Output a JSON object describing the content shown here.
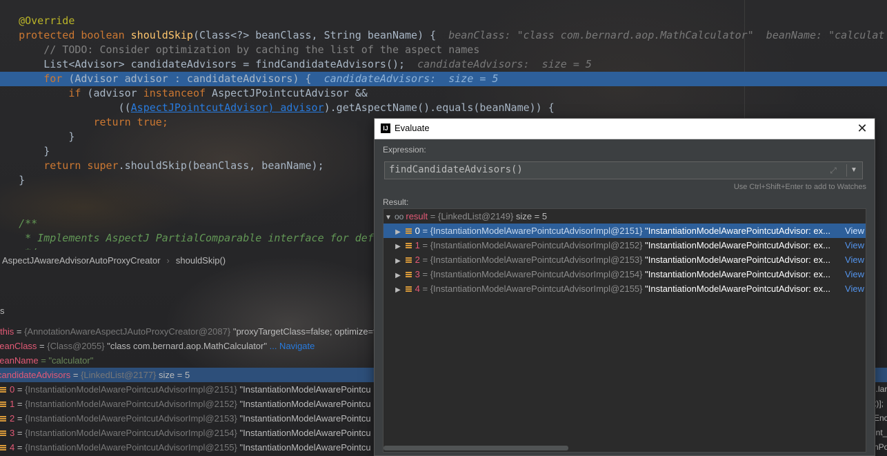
{
  "editor": {
    "lines": [
      {
        "t1": "@Override"
      },
      {
        "t1": "protected boolean ",
        "t2": "shouldSkip",
        "t3": "(Class<?> beanClass, String beanName) {  ",
        "hint": "beanClass: \"class com.bernard.aop.MathCalculator\"  beanName: \"calculat"
      },
      {
        "t1": "    // TODO: Consider optimization by caching the list of the aspect names"
      },
      {
        "t1": "    List<Advisor> candidateAdvisors = findCandidateAdvisors();  ",
        "hint": "candidateAdvisors:  size = 5"
      },
      {
        "t1": "    for",
        "t2": " (Advisor advisor : candidateAdvisors) {  ",
        "hint": "candidateAdvisors:  size = 5"
      },
      {
        "t1": "        if",
        "t2": " (advisor ",
        "t3": "instanceof",
        "t4": " AspectJPointcutAdvisor &&"
      },
      {
        "t1": "                ((",
        "t2": "AspectJPointcutAdvisor) advisor",
        "t3": ").getAspectName().equals(beanName)) {"
      },
      {
        "t1": "            return true",
        "t2": ";"
      },
      {
        "t1": "        }"
      },
      {
        "t1": "    }"
      },
      {
        "t1": "    return super",
        "t2": ".shouldSkip(beanClass, beanName);"
      },
      {
        "t1": "}"
      },
      {
        "t1": "/**"
      },
      {
        "t1": " * Implements AspectJ PartialComparable interface for def"
      },
      {
        "t1": " */"
      }
    ]
  },
  "breadcrumb": {
    "class_name": "AspectJAwareAdvisorAutoProxyCreator",
    "method_name": "shouldSkip()"
  },
  "variables": {
    "rows": [
      {
        "name": "this",
        "ref": "{AnnotationAwareAspectJAutoProxyCreator@2087}",
        "value": "\"proxyTargetClass=false; optimize=f"
      },
      {
        "name": "beanClass",
        "ref": "{Class@2055}",
        "value": "\"class com.bernard.aop.MathCalculator\"",
        "link": "... Navigate"
      },
      {
        "name": "beanName",
        "ref": "",
        "value": "= \"calculator\""
      },
      {
        "name": "candidateAdvisors",
        "ref": "{LinkedList@2177}",
        "value": "size = 5"
      }
    ],
    "items": [
      {
        "idx": "0",
        "ref": "{InstantiationModelAwarePointcutAdvisorImpl@2151}",
        "value": "\"InstantiationModelAwarePointcu",
        "tail": "j.lar"
      },
      {
        "idx": "1",
        "ref": "{InstantiationModelAwarePointcutAdvisorImpl@2152}",
        "value": "\"InstantiationModelAwarePointcu",
        "tail": "t)];"
      },
      {
        "idx": "2",
        "ref": "{InstantiationModelAwarePointcutAdvisorImpl@2153}",
        "value": "\"InstantiationModelAwarePointcu",
        "tail": "Enc"
      },
      {
        "idx": "3",
        "ref": "{InstantiationModelAwarePointcutAdvisorImpl@2154}",
        "value": "\"InstantiationModelAwarePointcu",
        "tail": "int_"
      },
      {
        "idx": "4",
        "ref": "{InstantiationModelAwarePointcutAdvisorImpl@2155}",
        "value": "\"InstantiationModelAwarePointcu",
        "tail": "nPo"
      }
    ]
  },
  "dialog": {
    "title": "Evaluate",
    "expression_label": "Expression:",
    "expression": "findCandidateAdvisors()",
    "watch_hint": "Use Ctrl+Shift+Enter to add to Watches",
    "result_label": "Result:",
    "result": {
      "name": "result",
      "ref": "= {LinkedList@2149}",
      "size": "size = 5"
    },
    "items": [
      {
        "idx": "0",
        "ref": "= {InstantiationModelAwarePointcutAdvisorImpl@2151}",
        "value": "\"InstantiationModelAwarePointcutAdvisor: ex...",
        "view": "View"
      },
      {
        "idx": "1",
        "ref": "= {InstantiationModelAwarePointcutAdvisorImpl@2152}",
        "value": "\"InstantiationModelAwarePointcutAdvisor: ex...",
        "view": "View"
      },
      {
        "idx": "2",
        "ref": "= {InstantiationModelAwarePointcutAdvisorImpl@2153}",
        "value": "\"InstantiationModelAwarePointcutAdvisor: ex...",
        "view": "View"
      },
      {
        "idx": "3",
        "ref": "= {InstantiationModelAwarePointcutAdvisorImpl@2154}",
        "value": "\"InstantiationModelAwarePointcutAdvisor: ex...",
        "view": "View"
      },
      {
        "idx": "4",
        "ref": "= {InstantiationModelAwarePointcutAdvisorImpl@2155}",
        "value": "\"InstantiationModelAwarePointcutAdvisor: ex...",
        "view": "View"
      }
    ]
  }
}
